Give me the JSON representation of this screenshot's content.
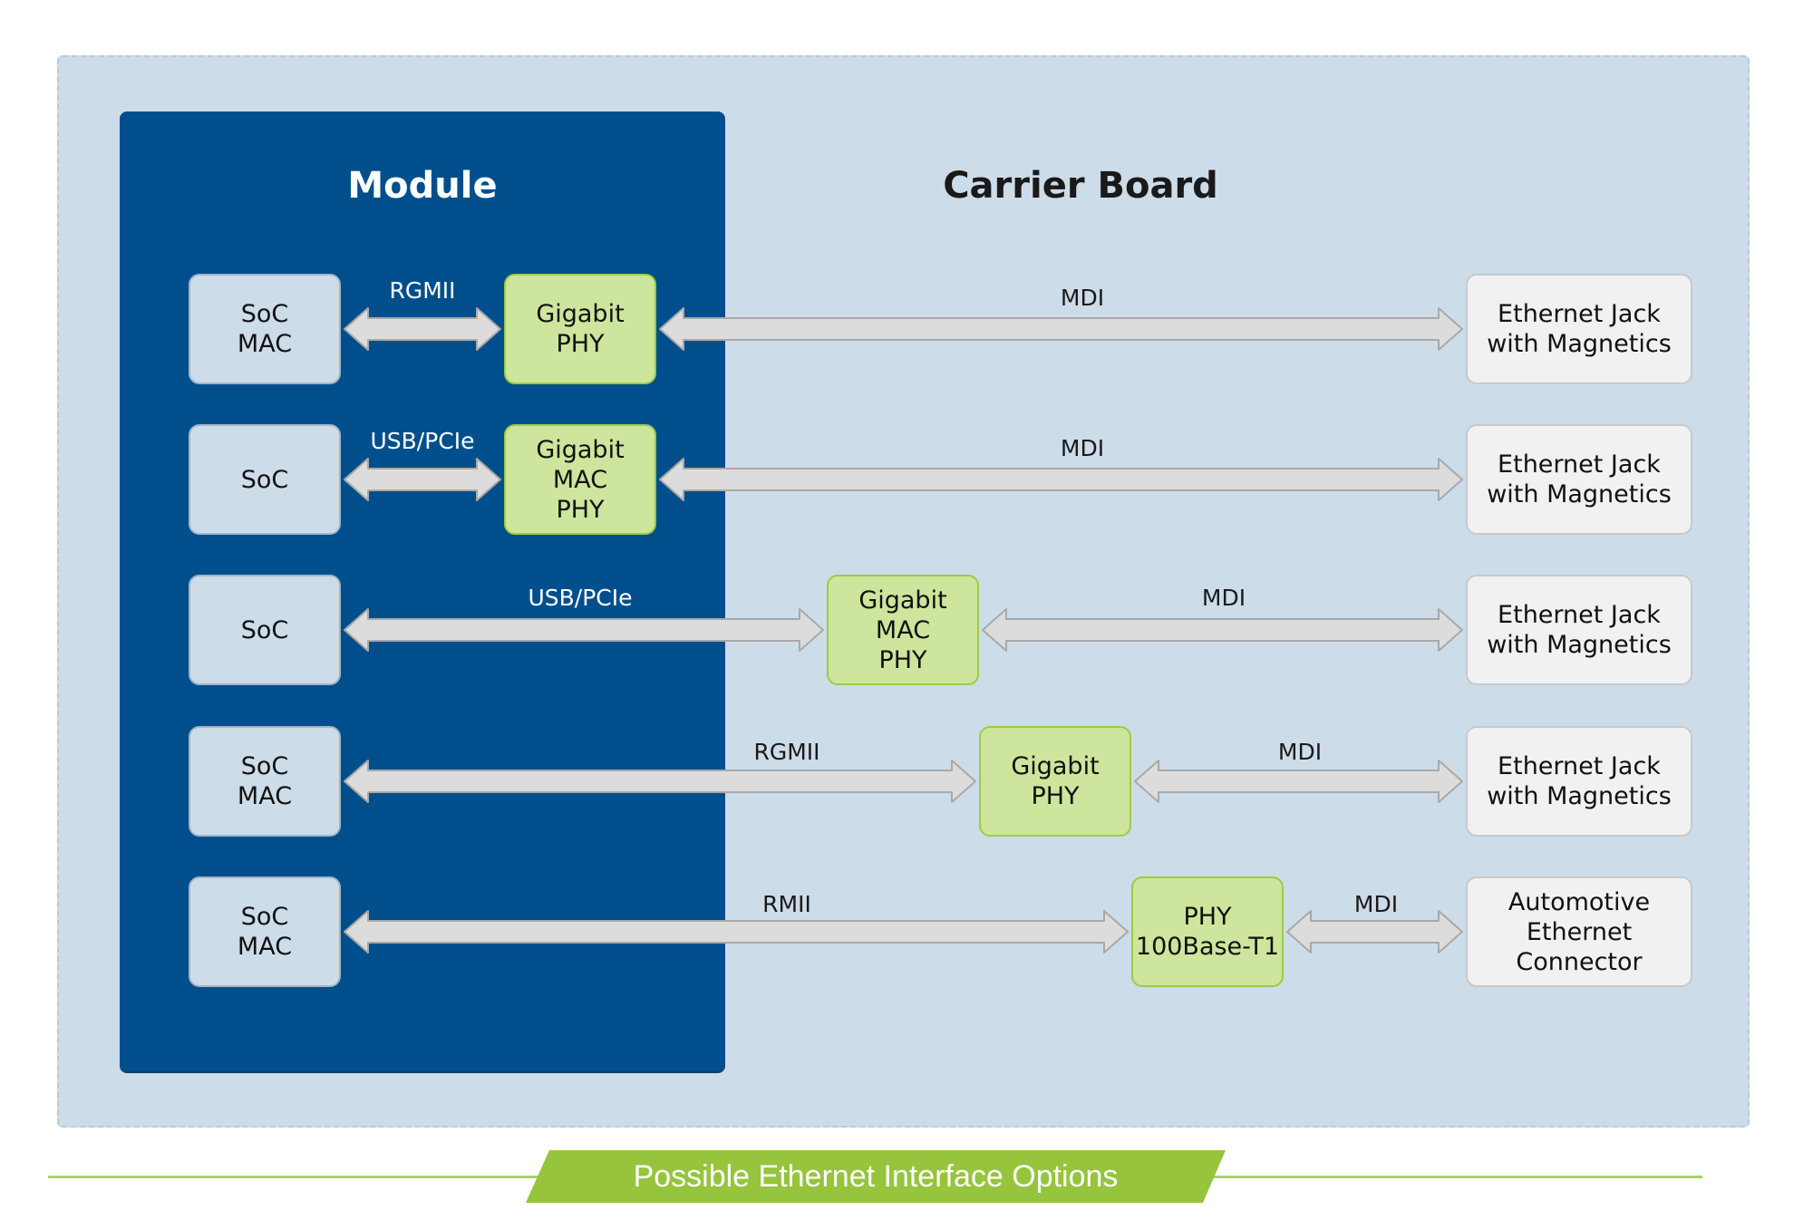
{
  "sections": {
    "module_title": "Module",
    "carrier_title": "Carrier Board"
  },
  "colors": {
    "module_bg": "#004f8c",
    "carrier_bg": "#cddce9",
    "phy_green": "#cde59c",
    "phy_border": "#9ccc44",
    "connector_bg": "#f1f1f1",
    "arrow_fill": "#dcdcdc",
    "arrow_stroke": "#a9a9a9",
    "banner_green": "#96c43c"
  },
  "rows": [
    {
      "soc": "SoC\nMAC",
      "link1": "RGMII",
      "phy": "Gigabit\nPHY",
      "link2": "MDI",
      "connector": "Ethernet Jack\nwith Magnetics"
    },
    {
      "soc": "SoC",
      "link1": "USB/PCIe",
      "phy": "Gigabit\nMAC\nPHY",
      "link2": "MDI",
      "connector": "Ethernet Jack\nwith Magnetics"
    },
    {
      "soc": "SoC",
      "link1": "USB/PCIe",
      "phy": "Gigabit\nMAC\nPHY",
      "link2": "MDI",
      "connector": "Ethernet Jack\nwith Magnetics"
    },
    {
      "soc": "SoC\nMAC",
      "link1": "RGMII",
      "phy": "Gigabit\nPHY",
      "link2": "MDI",
      "connector": "Ethernet Jack\nwith Magnetics"
    },
    {
      "soc": "SoC\nMAC",
      "link1": "RMII",
      "phy": "PHY\n100Base-T1",
      "link2": "MDI",
      "connector": "Automotive\nEthernet\nConnector"
    }
  ],
  "caption": "Possible Ethernet Interface Options"
}
